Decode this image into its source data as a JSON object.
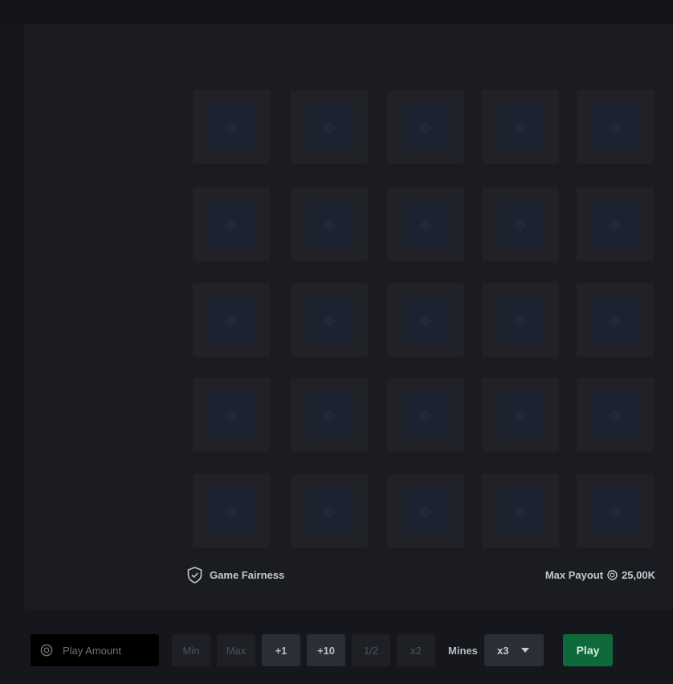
{
  "game": {
    "tile_count": 25,
    "tile_icon": "gem-icon"
  },
  "footer": {
    "fairness_label": "Game Fairness",
    "fairness_icon": "shield-check-icon",
    "max_payout_label": "Max Payout",
    "max_payout_value": "25,00K",
    "coin_icon": "coin-icon"
  },
  "controls": {
    "amount_placeholder": "Play Amount",
    "amount_icon": "coin-icon",
    "buttons": {
      "min": "Min",
      "max": "Max",
      "plus1": "+1",
      "plus10": "+10",
      "half": "1/2",
      "double": "x2"
    },
    "mines_label": "Mines",
    "mines_value": "x3",
    "play_label": "Play"
  },
  "colors": {
    "play_button": "#0e6a3a",
    "background": "#15171c",
    "board": "#1a1c22"
  }
}
